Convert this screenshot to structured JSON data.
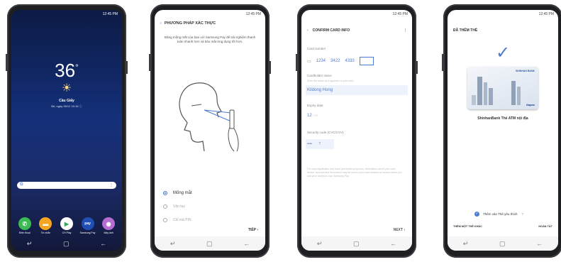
{
  "status_time": "12:45 PM",
  "phone1": {
    "temperature": "36",
    "degree": "°",
    "condition": "Cầu Giấy",
    "location_line": "Bé, ngày 06/12 15:16 ⓘ",
    "search_logo": "G",
    "dock": [
      {
        "label": "Điện thoại",
        "glyph": "✆",
        "color": "#3cba54"
      },
      {
        "label": "Tin nhắn",
        "glyph": "▬",
        "color": "#f6a623"
      },
      {
        "label": "CH Play",
        "glyph": "▶",
        "color": "#ffffff"
      },
      {
        "label": "Samsung Pay",
        "glyph": "pay",
        "color": "#1f4fb5"
      },
      {
        "label": "Máy ảnh",
        "glyph": "◉",
        "color": "#b56cd1"
      }
    ]
  },
  "phone2": {
    "title": "PHƯƠNG PHÁP XÁC THỰC",
    "description": "Đăng mống mắt của bạn với Samsung Pay để trải nghiệm thanh toán nhanh hơn và bảo mật ứng dụng tốt hơn.",
    "options": [
      {
        "label": "Mống mắt",
        "selected": true
      },
      {
        "label": "Vân tay",
        "selected": false
      },
      {
        "label": "Chỉ mã PIN",
        "selected": false
      }
    ],
    "next_label": "TIẾP"
  },
  "phone3": {
    "title": "CONFIRM CARD INFO",
    "card_number_label": "Card number",
    "card_number_groups": [
      "1234",
      "3422",
      "4333"
    ],
    "cardholder_label": "Cardholder name",
    "cardholder_hint": "Enter the name as it appears on your card.",
    "cardholder_value": "Kildong Hong",
    "expiry_label": "Expiry date",
    "expiry_month": "12",
    "expiry_year": "YY",
    "security_label": "Security code (CVC/CVV)",
    "security_value": "••••",
    "terms": "For card registration and fraud prevention purposes, information about your card, device, account and its location may be sent to your card network or issuers when you add your card(s) to use Samsung Pay.",
    "next_label": "NEXT"
  },
  "phone4": {
    "title": "ĐÃ THÊM THẺ",
    "card_bank": "SHINHAN BANK",
    "card_network": "Napas",
    "card_name": "ShinhanBank Thẻ ATM nội địa",
    "favorite_label": "Thêm vào Thẻ yêu thích",
    "add_another": "THÊM MỘT THẺ KHÁC",
    "done": "HOÀN TẤT"
  },
  "nav_glyphs": [
    "↵",
    "▢",
    "←"
  ]
}
